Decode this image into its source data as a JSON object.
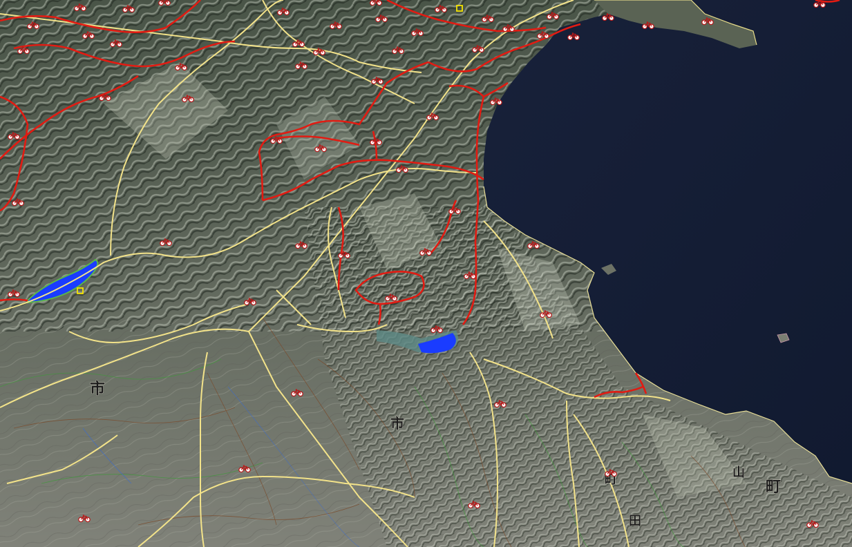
{
  "map": {
    "view": "3d-perspective-terrain",
    "style": "shaded relief with topographic contours",
    "colors": {
      "sea": "#141c33",
      "lake": "#1a3cff",
      "terrain_dark": "#2f3a30",
      "terrain_light": "#8f958c",
      "plain": "#7e807a",
      "route_main": "#e21b12",
      "route_secondary": "#f3e38a",
      "contour_green": "#2e8b2e",
      "contour_brown": "#7a4a2a",
      "marker_fill": "#ffffff",
      "marker_stroke": "#c01818",
      "waypoint_yellow": "#f5e400"
    },
    "marker_icon": "bicycle-icon",
    "waypoint_icon": "square-waypoint-icon",
    "labels": [
      {
        "id": "label-1",
        "text": "市"
      },
      {
        "id": "label-2",
        "text": "町"
      },
      {
        "id": "label-3",
        "text": "山"
      },
      {
        "id": "label-4",
        "text": "市"
      },
      {
        "id": "label-5",
        "text": "町"
      },
      {
        "id": "label-6",
        "text": "田"
      }
    ]
  }
}
